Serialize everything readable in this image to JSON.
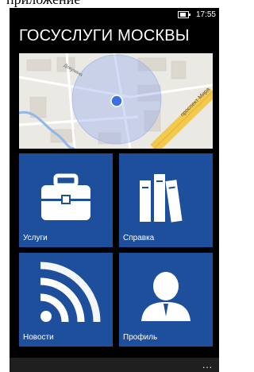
{
  "clipped_caption": "приложение",
  "status": {
    "time": "17:55",
    "battery_icon": "battery-icon"
  },
  "title": "ГОСУСЛУГИ МОСКВЫ",
  "map": {
    "street_label_1": "проспект Мира",
    "street_label_2": "Докучина",
    "location_icon": "location-dot-icon"
  },
  "tiles": [
    {
      "label": "Услуги",
      "icon": "briefcase-icon"
    },
    {
      "label": "Справка",
      "icon": "books-icon"
    },
    {
      "label": "Новости",
      "icon": "rss-icon"
    },
    {
      "label": "Профиль",
      "icon": "person-icon"
    }
  ],
  "appbar": {
    "more": "..."
  },
  "colors": {
    "tile": "#1e4f9c",
    "background": "#000000",
    "road": "#f2c94c",
    "location": "#3c6fe0"
  }
}
